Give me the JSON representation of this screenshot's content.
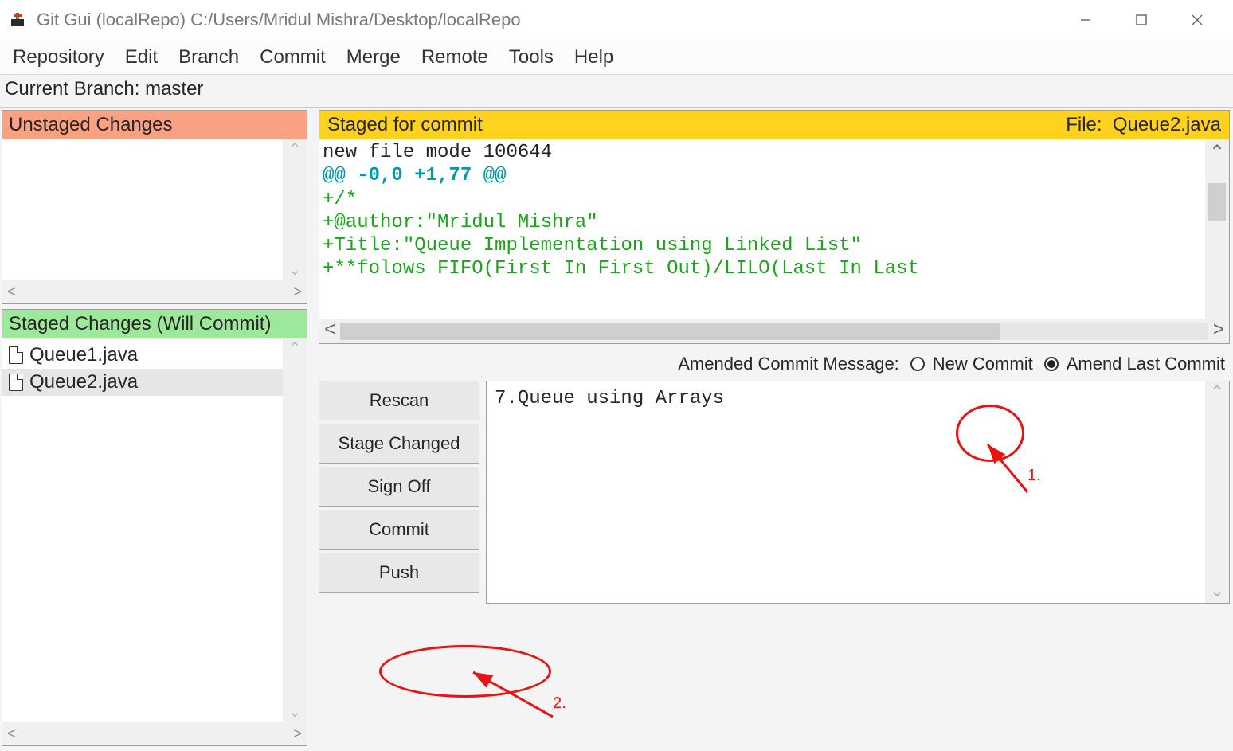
{
  "titlebar": {
    "title": "Git Gui (localRepo) C:/Users/Mridul Mishra/Desktop/localRepo"
  },
  "menu": {
    "items": [
      "Repository",
      "Edit",
      "Branch",
      "Commit",
      "Merge",
      "Remote",
      "Tools",
      "Help"
    ]
  },
  "branch_row": {
    "label": "Current Branch: ",
    "name": "master"
  },
  "unstaged": {
    "header": "Unstaged Changes",
    "files": []
  },
  "staged": {
    "header": "Staged Changes (Will Commit)",
    "files": [
      "Queue1.java",
      "Queue2.java"
    ],
    "selected_index": 1
  },
  "diff": {
    "header_left": "Staged for commit",
    "file_label": "File:",
    "file_name": "Queue2.java",
    "lines": [
      {
        "cls": "dl-norm",
        "t": "new file mode 100644"
      },
      {
        "cls": "dl-hunk",
        "t": "@@ -0,0 +1,77 @@"
      },
      {
        "cls": "dl-add",
        "t": "+/*"
      },
      {
        "cls": "dl-add",
        "t": "+@author:\"Mridul Mishra\""
      },
      {
        "cls": "dl-add",
        "t": "+Title:\"Queue Implementation using Linked List\""
      },
      {
        "cls": "dl-add",
        "t": "+**folows FIFO(First In First Out)/LILO(Last In Last"
      }
    ]
  },
  "commit_opts": {
    "label": "Amended Commit Message:",
    "new_commit": "New Commit",
    "amend": "Amend Last Commit",
    "selected": "amend"
  },
  "buttons": {
    "rescan": "Rescan",
    "stage_changed": "Stage Changed",
    "sign_off": "Sign Off",
    "commit": "Commit",
    "push": "Push"
  },
  "commit_message": "7.Queue using Arrays",
  "annotations": {
    "one": "1.",
    "two": "2."
  }
}
